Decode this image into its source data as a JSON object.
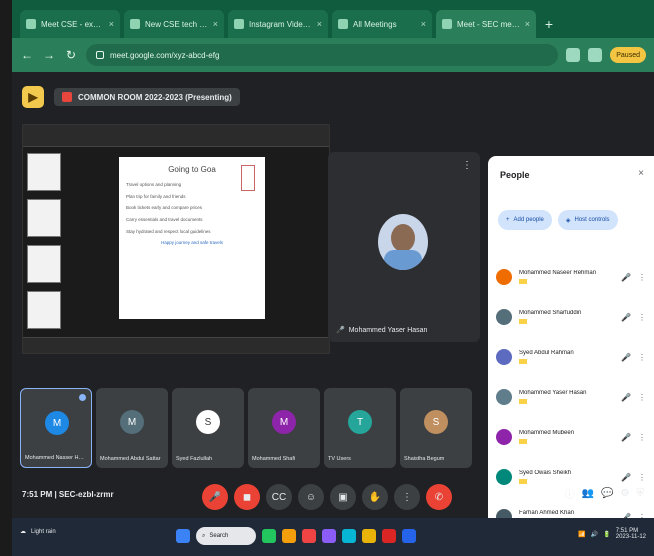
{
  "browser": {
    "tabs": [
      {
        "label": "Meet CSE - examtest"
      },
      {
        "label": "New CSE tech - Google"
      },
      {
        "label": "Instagram Videos for"
      },
      {
        "label": "All Meetings"
      },
      {
        "label": "Meet - SEC meeting"
      }
    ],
    "url": "meet.google.com/xyz-abcd-efg",
    "profile": "Paused"
  },
  "meet": {
    "presentation_title": "COMMON ROOM 2022-2023 (Presenting)",
    "slide": {
      "title": "Going to Goa",
      "lines": [
        "Travel options and planning",
        "Plan trip for family and friends",
        "Book tickets early and compare prices",
        "Carry essentials and travel documents",
        "Stay hydrated and respect local guidelines"
      ],
      "subtitle": "Happy journey and safe travels"
    },
    "speaker_name": "Mohammed Yaser Hasan",
    "filmstrip": [
      {
        "name": "Mohammed Nasser Hussain",
        "initial": "M",
        "color": "#1e88e5"
      },
      {
        "name": "Mohammed Abdul Sattar",
        "initial": "M",
        "color": "#546e7a"
      },
      {
        "name": "Syed Fazlullah",
        "initial": "S",
        "color": "#ffffff"
      },
      {
        "name": "Mohammed Shafi",
        "initial": "M",
        "color": "#8e24aa"
      },
      {
        "name": "TV Users",
        "initial": "T",
        "color": "#26a69a"
      },
      {
        "name": "Shaistha Begum",
        "initial": "S",
        "color": "#bf8f5f"
      }
    ]
  },
  "panel": {
    "title": "People",
    "buttons": [
      "Add people",
      "Host controls"
    ],
    "people": [
      {
        "name": "Mohammed Naseer Rehman",
        "color": "#ef6c00"
      },
      {
        "name": "Mohammed Sharfuddin",
        "color": "#546e7a"
      },
      {
        "name": "Syed Abdul Rahman",
        "color": "#5c6bc0"
      },
      {
        "name": "Mohammed Yaser Hasan",
        "color": "#607d8b"
      },
      {
        "name": "Mohammed Mubeen",
        "color": "#8e24aa"
      },
      {
        "name": "Syed Owais Sheikh",
        "color": "#00897b"
      },
      {
        "name": "Farhan Ahmed Khan",
        "color": "#455a64"
      }
    ]
  },
  "controls": {
    "status_text": "7:51 PM | SEC-ezbl-zrmr"
  },
  "taskbar": {
    "weather": "Light rain",
    "search": "Search",
    "time": "7:51 PM",
    "date": "2023-11-12"
  }
}
